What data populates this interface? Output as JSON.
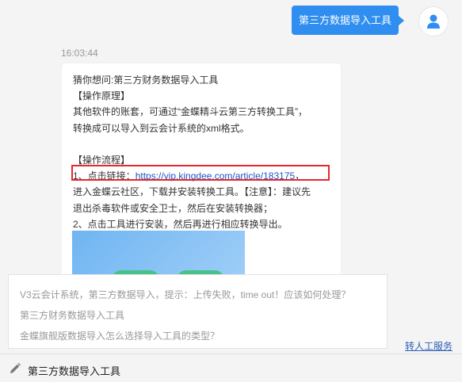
{
  "user_message": "第三方数据导入工具",
  "timestamp": "16:03:44",
  "bot_reply": {
    "lines": [
      "猜你想问:第三方财务数据导入工具",
      "【操作原理】",
      "其他软件的账套，可通过“金蝶精斗云第三方转换工具”，",
      "转换成可以导入到云会计系统的xml格式。",
      "",
      "【操作流程】"
    ],
    "step1_prefix": "1、点击链接：",
    "step1_link": "https://vip.kingdee.com/article/183175",
    "step1_suffix": "，",
    "lines_after": [
      "进入金蝶云社区，下载并安装转换工具。【注意】：建议先",
      "退出杀毒软件或安全卫士，然后在安装转换器；",
      "2、点击工具进行安装，然后再进行相应转换导出。"
    ]
  },
  "suggestions": [
    "V3云会计系统，第三方数据导入，提示：上传失败，time out！应该如何处理？",
    "第三方财务数据导入工具",
    "金蝶旗舰版数据导入怎么选择导入工具的类型？"
  ],
  "transfer_label": "转人工服务",
  "input_value": "第三方数据导入工具",
  "icons": {
    "avatar": "user-avatar-icon",
    "input": "pencil-icon"
  },
  "colors": {
    "accent": "#2f8ef0",
    "highlight": "#e8262b",
    "link": "#1a56c4"
  }
}
